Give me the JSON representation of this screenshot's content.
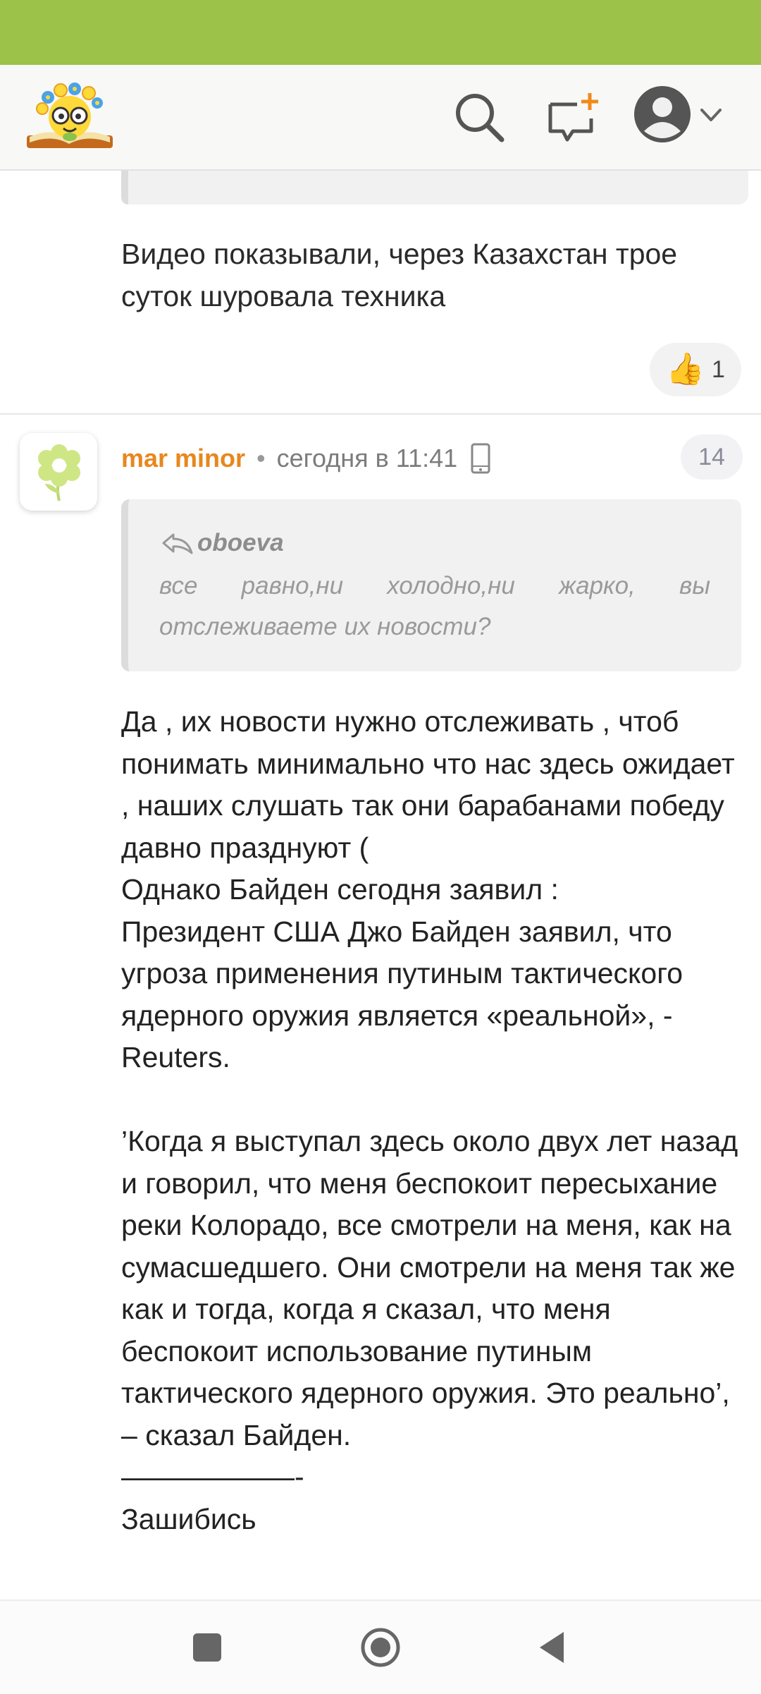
{
  "header": {
    "logo": "site-logo",
    "icons": [
      "search-icon",
      "compose-icon",
      "user-avatar-icon",
      "chevron-down-icon"
    ]
  },
  "previous_comment": {
    "text": "Видео показывали, через Казахстан трое суток шуровала техника",
    "likes": "1"
  },
  "comment": {
    "author": "mar minor",
    "separator": "•",
    "time": "сегодня в 11:41",
    "number": "14",
    "quote": {
      "author": "oboeva",
      "text": "все равно,ни холодно,ни жарко, вы отслеживаете их новости?"
    },
    "text": "Да , их новости нужно отслеживать , чтоб понимать минимально что нас здесь ожидает , наших слушать так они барабанами победу давно празднуют (\nОднако Байден сегодня заявил :\nПрезидент США Джо Байден заявил, что угроза применения путиным тактического ядерного оружия является «реальной», - Reuters.\n\n’Когда я выступал здесь около двух лет назад и говорил, что меня беспокоит пересыхание реки Колорадо, все смотрели на меня, как на сумасшедшего. Они смотрели на меня так же как и тогда, когда я сказал, что меня беспокоит использование путиным тактического ядерного оружия. Это реально’, – сказал Байден.\n——————-\nЗашибись"
  },
  "colors": {
    "status_bar": "#9cc24a",
    "author": "#e8871e"
  }
}
